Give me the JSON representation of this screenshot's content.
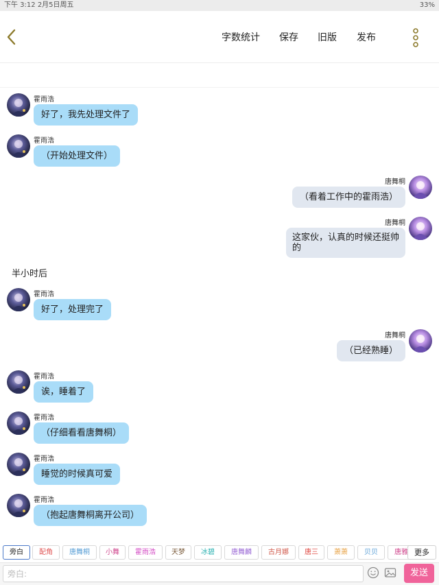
{
  "status_bar": {
    "left_text": "下午 3:12   2月5日周五",
    "right_text": "33%"
  },
  "header": {
    "buttons": [
      "字数统计",
      "保存",
      "旧版",
      "发布"
    ]
  },
  "colors": {
    "bubble_left": "#a9dcf8",
    "bubble_right": "#e1e7f0",
    "send_button": "#f0639a"
  },
  "messages": [
    {
      "side": "left",
      "sender": "霍雨浩",
      "text": "好了，我先处理文件了"
    },
    {
      "side": "left",
      "sender": "霍雨浩",
      "text": "（开始处理文件）"
    },
    {
      "side": "right",
      "sender": "唐舞桐",
      "text": "（看着工作中的霍雨浩）"
    },
    {
      "side": "right",
      "sender": "唐舞桐",
      "lines": [
        "这家伙，认真的时候还挺帅",
        "的"
      ]
    },
    {
      "side": "narration",
      "text": "半小时后"
    },
    {
      "side": "left",
      "sender": "霍雨浩",
      "text": "好了，处理完了"
    },
    {
      "side": "right",
      "sender": "唐舞桐",
      "text": "（已经熟睡）"
    },
    {
      "side": "left",
      "sender": "霍雨浩",
      "text": "诶，睡着了"
    },
    {
      "side": "left",
      "sender": "霍雨浩",
      "text": "（仔细看看唐舞桐）"
    },
    {
      "side": "left",
      "sender": "霍雨浩",
      "text": "睡觉的时候真可爱"
    },
    {
      "side": "left",
      "sender": "霍雨浩",
      "text": "（抱起唐舞桐离开公司）"
    }
  ],
  "roles": [
    {
      "label": "旁白",
      "color": "#222222",
      "active": true
    },
    {
      "label": "配角",
      "color": "#e05656"
    },
    {
      "label": "唐舞桐",
      "color": "#5a9fd6"
    },
    {
      "label": "小舞",
      "color": "#d04a8f"
    },
    {
      "label": "霍雨浩",
      "color": "#d34bc4"
    },
    {
      "label": "天梦",
      "color": "#7a5a3a"
    },
    {
      "label": "冰碧",
      "color": "#2fb3b3"
    },
    {
      "label": "唐舞麟",
      "color": "#9b6ad6"
    },
    {
      "label": "古月娜",
      "color": "#d0584a"
    },
    {
      "label": "唐三",
      "color": "#e0504a"
    },
    {
      "label": "萧萧",
      "color": "#e8a44a"
    },
    {
      "label": "贝贝",
      "color": "#5a9fd6"
    },
    {
      "label": "唐雅",
      "color": "#d04a8f"
    }
  ],
  "more_label": "更多",
  "input": {
    "placeholder": "旁白:",
    "value": ""
  },
  "send_label": "发送"
}
